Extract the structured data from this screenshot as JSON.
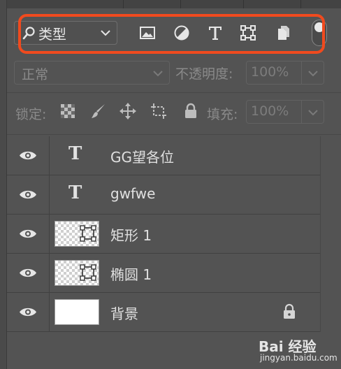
{
  "filter": {
    "kind_label": "类型",
    "icons": [
      "image-filter-icon",
      "adjustment-filter-icon",
      "type-filter-icon",
      "shape-filter-icon",
      "smart-object-filter-icon"
    ]
  },
  "blend": {
    "mode": "正常"
  },
  "opacity": {
    "label": "不透明度:",
    "value": "100%"
  },
  "lock": {
    "label": "锁定:"
  },
  "fill": {
    "label": "填充:",
    "value": "100%"
  },
  "layers": [
    {
      "name": "GG望各位",
      "kind": "text"
    },
    {
      "name": "gwfwe",
      "kind": "text"
    },
    {
      "name": "矩形 1",
      "kind": "shape"
    },
    {
      "name": "椭圆 1",
      "kind": "shape"
    },
    {
      "name": "背景",
      "kind": "background",
      "locked": true
    }
  ],
  "watermark": {
    "brand": "Bai 经验",
    "url": "jingyan.baidu.com"
  },
  "colors": {
    "highlight": "#f04a1e",
    "panel": "#535353"
  }
}
